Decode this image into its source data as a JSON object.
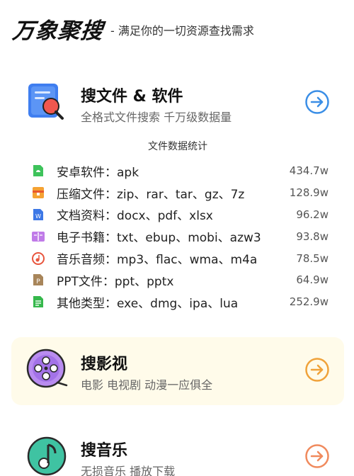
{
  "header": {
    "brand": "万象聚搜",
    "slogan": "- 满足你的一切资源查找需求"
  },
  "files_card": {
    "title": "搜文件 & 软件",
    "subtitle": "全格式文件搜索 千万级数据量",
    "stats_title": "文件数据统计",
    "rows": [
      {
        "label": "安卓软件：apk",
        "count": "434.7w",
        "icon": "android-file-icon"
      },
      {
        "label": "压缩文件：zip、rar、tar、gz、7z",
        "count": "128.9w",
        "icon": "archive-file-icon"
      },
      {
        "label": "文档资料：docx、pdf、xlsx",
        "count": "96.2w",
        "icon": "word-doc-icon"
      },
      {
        "label": "电子书籍：txt、ebup、mobi、azw3",
        "count": "93.8w",
        "icon": "ebook-icon"
      },
      {
        "label": "音乐音频：mp3、flac、wma、m4a",
        "count": "78.5w",
        "icon": "music-disc-icon"
      },
      {
        "label": "PPT文件：ppt、pptx",
        "count": "64.9w",
        "icon": "ppt-file-icon"
      },
      {
        "label": "其他类型：exe、dmg、ipa、lua",
        "count": "252.9w",
        "icon": "other-file-icon"
      }
    ],
    "accent": "#3a8ee6"
  },
  "video_card": {
    "title": "搜影视",
    "subtitle": "电影 电视剧 动漫一应俱全",
    "accent": "#f0a23a"
  },
  "music_card": {
    "title": "搜音乐",
    "subtitle": "无损音乐 播放下载",
    "accent": "#f08a5d"
  }
}
